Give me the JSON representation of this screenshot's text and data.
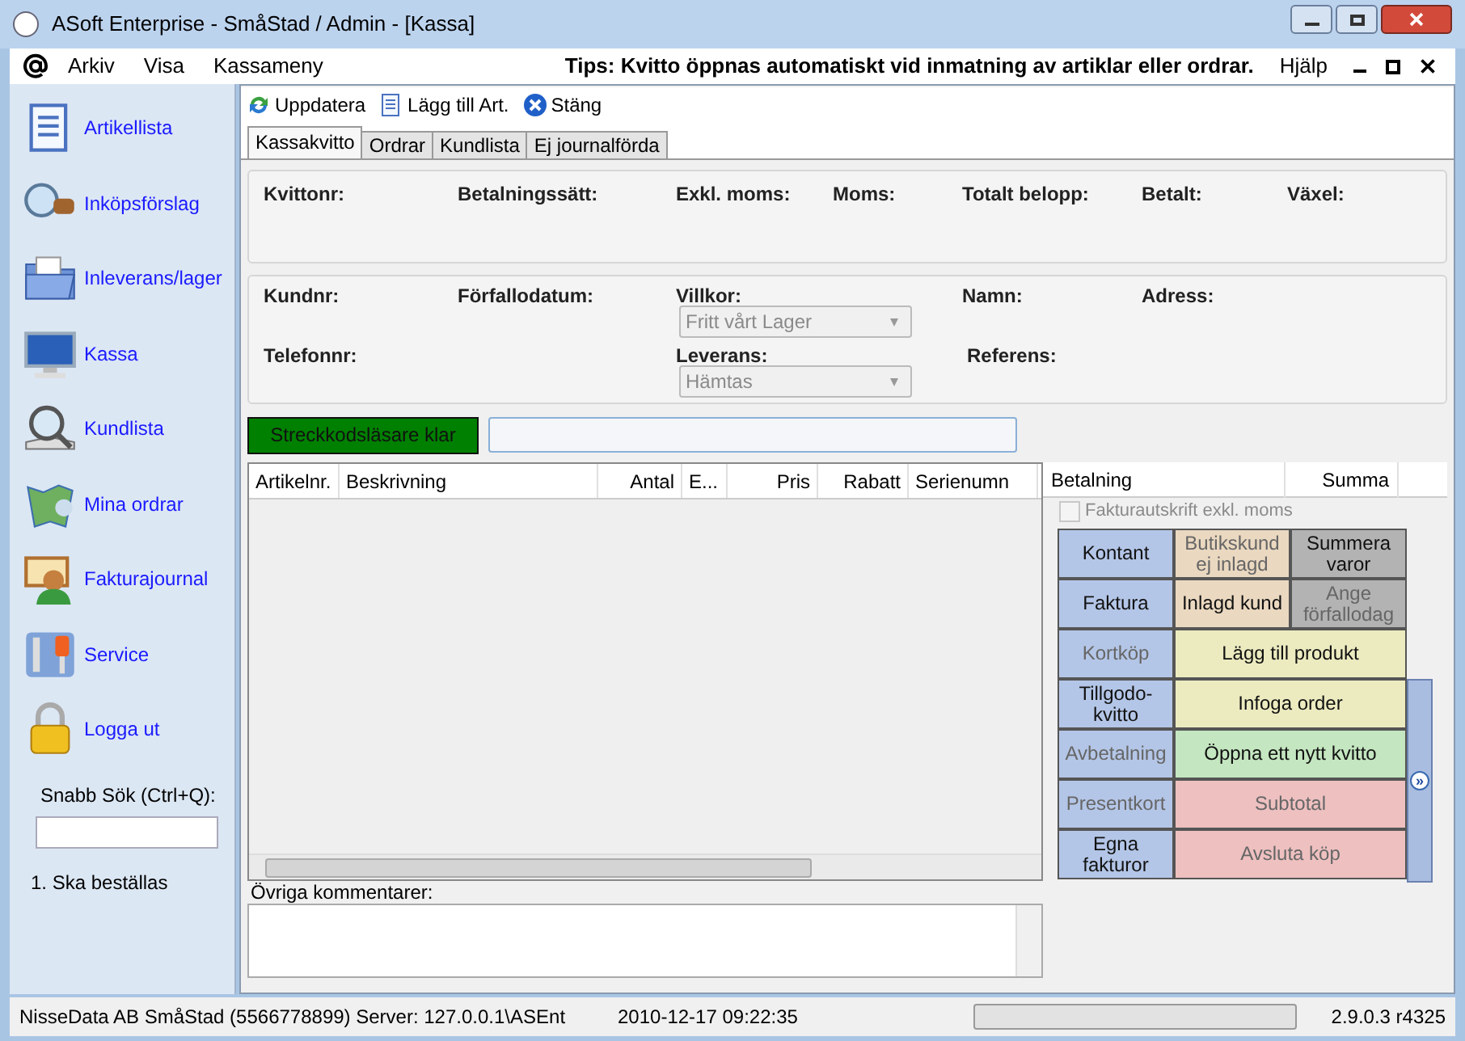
{
  "window": {
    "title": "ASoft Enterprise - SmåStad / Admin - [Kassa]"
  },
  "menu": [
    "Arkiv",
    "Visa",
    "Kassameny"
  ],
  "tip": "Tips: Kvitto öppnas automatiskt vid inmatning av artiklar eller ordrar.",
  "help_menu": "Hjälp",
  "sidebar": {
    "items": [
      {
        "label": "Artikellista"
      },
      {
        "label": "Inköpsförslag"
      },
      {
        "label": "Inleverans/lager"
      },
      {
        "label": "Kassa"
      },
      {
        "label": "Kundlista"
      },
      {
        "label": "Mina ordrar"
      },
      {
        "label": "Fakturajournal"
      },
      {
        "label": "Service"
      },
      {
        "label": "Logga ut"
      }
    ],
    "search_label": "Snabb Sök (Ctrl+Q):",
    "note": "1. Ska beställas"
  },
  "toolbar": [
    {
      "label": "Uppdatera"
    },
    {
      "label": "Lägg till Art."
    },
    {
      "label": "Stäng"
    }
  ],
  "tabs": [
    {
      "label": "Kassakvitto",
      "selected": true
    },
    {
      "label": "Ordrar",
      "selected": false
    },
    {
      "label": "Kundlista",
      "selected": false
    },
    {
      "label": "Ej journalförda",
      "selected": false
    }
  ],
  "receipt_fields": [
    "Kvittonr:",
    "Betalningssätt:",
    "Exkl. moms:",
    "Moms:",
    "Totalt belopp:",
    "Betalt:",
    "Växel:"
  ],
  "customer": {
    "kundnr": "Kundnr:",
    "forfallodatum": "Förfallodatum:",
    "villkor": "Villkor:",
    "villkor_value": "Fritt vårt Lager",
    "namn": "Namn:",
    "adress": "Adress:",
    "telefonnr": "Telefonnr:",
    "leverans": "Leverans:",
    "leverans_value": "Hämtas",
    "referens": "Referens:",
    "combos_disabled": true
  },
  "barcode_status": "Streckkodsläsare klar",
  "table": {
    "columns": [
      "Artikelnr.",
      "Beskrivning",
      "Antal",
      "E...",
      "Pris",
      "Rabatt",
      "Serienumn"
    ]
  },
  "payments": {
    "columns": [
      "Betalning",
      "Summa"
    ]
  },
  "invoice_checkbox": {
    "label": "Fakturautskrift exkl. moms",
    "checked": false,
    "disabled": true
  },
  "buttons": [
    {
      "label": "Kontant",
      "color": "#b4c6e7",
      "disabled": false
    },
    {
      "label": "Butikskund ej inlagd",
      "color": "#ead8c0",
      "disabled": true
    },
    {
      "label": "Summera varor",
      "color": "#b3b3b3",
      "disabled": false
    },
    {
      "label": "Faktura",
      "color": "#b4c6e7",
      "disabled": false
    },
    {
      "label": "Inlagd kund",
      "color": "#ead8c0",
      "disabled": false
    },
    {
      "label": "Ange förfallodag",
      "color": "#b3b3b3",
      "disabled": true
    },
    {
      "label": "Kortköp",
      "color": "#b4c6e7",
      "disabled": true
    },
    {
      "label": "Lägg till produkt",
      "color": "#ecebc0",
      "disabled": false
    },
    {
      "label": "Tillgodo-kvitto",
      "color": "#b4c6e7",
      "disabled": false
    },
    {
      "label": "Infoga order",
      "color": "#ecebc0",
      "disabled": false
    },
    {
      "label": "Avbetalning",
      "color": "#b4c6e7",
      "disabled": true
    },
    {
      "label": "Öppna ett nytt kvitto",
      "color": "#c4e6c0",
      "disabled": false
    },
    {
      "label": "Presentkort",
      "color": "#b4c6e7",
      "disabled": true
    },
    {
      "label": "Subtotal",
      "color": "#eec0c0",
      "disabled": true
    },
    {
      "label": "Egna fakturor",
      "color": "#b4c6e7",
      "disabled": false
    },
    {
      "label": "Avsluta köp",
      "color": "#eec0c0",
      "disabled": true
    }
  ],
  "expand_button": "»",
  "comments_label": "Övriga kommentarer:",
  "status_bar": {
    "company": "NisseData AB SmåStad (5566778899) Server: 127.0.0.1\\ASEnt",
    "datetime": "2010-12-17 09:22:35",
    "version": "2.9.0.3 r4325",
    "progress": {
      "level": 0
    }
  }
}
